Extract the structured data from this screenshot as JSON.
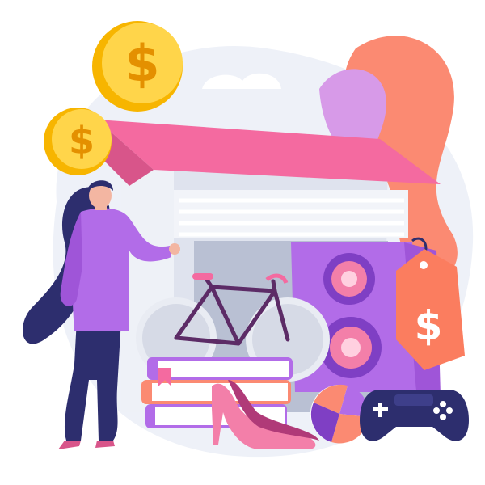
{
  "illustration": {
    "subject": "garage sale",
    "colors": {
      "background_blob": "#eef1f8",
      "roof": "#f46aa0",
      "roof_dark": "#d8558a",
      "wall": "#dfe3ee",
      "wall_light": "#eef1f7",
      "door_stripe": "#ffffff",
      "doorway": "#b9c0d3",
      "coin": "#f7b500",
      "coin_light": "#ffd54a",
      "coin_symbol": "#e49000",
      "purple": "#b26ce8",
      "purple_dark": "#7f3fc4",
      "navy": "#2d2e6e",
      "navy_dark": "#22235a",
      "pink": "#f37fa9",
      "orange_blob": "#fb8a72",
      "violet_blob": "#d79ae8",
      "tag": "#fb7d5f",
      "skin": "#f3b6a2"
    },
    "icons": [
      "dollar-coin-icon",
      "price-tag-icon",
      "game-controller-icon",
      "speaker-icon",
      "bicycle-icon",
      "beach-ball-icon",
      "high-heel-shoe-icon",
      "book-stack-icon"
    ],
    "price_symbol": "$"
  }
}
